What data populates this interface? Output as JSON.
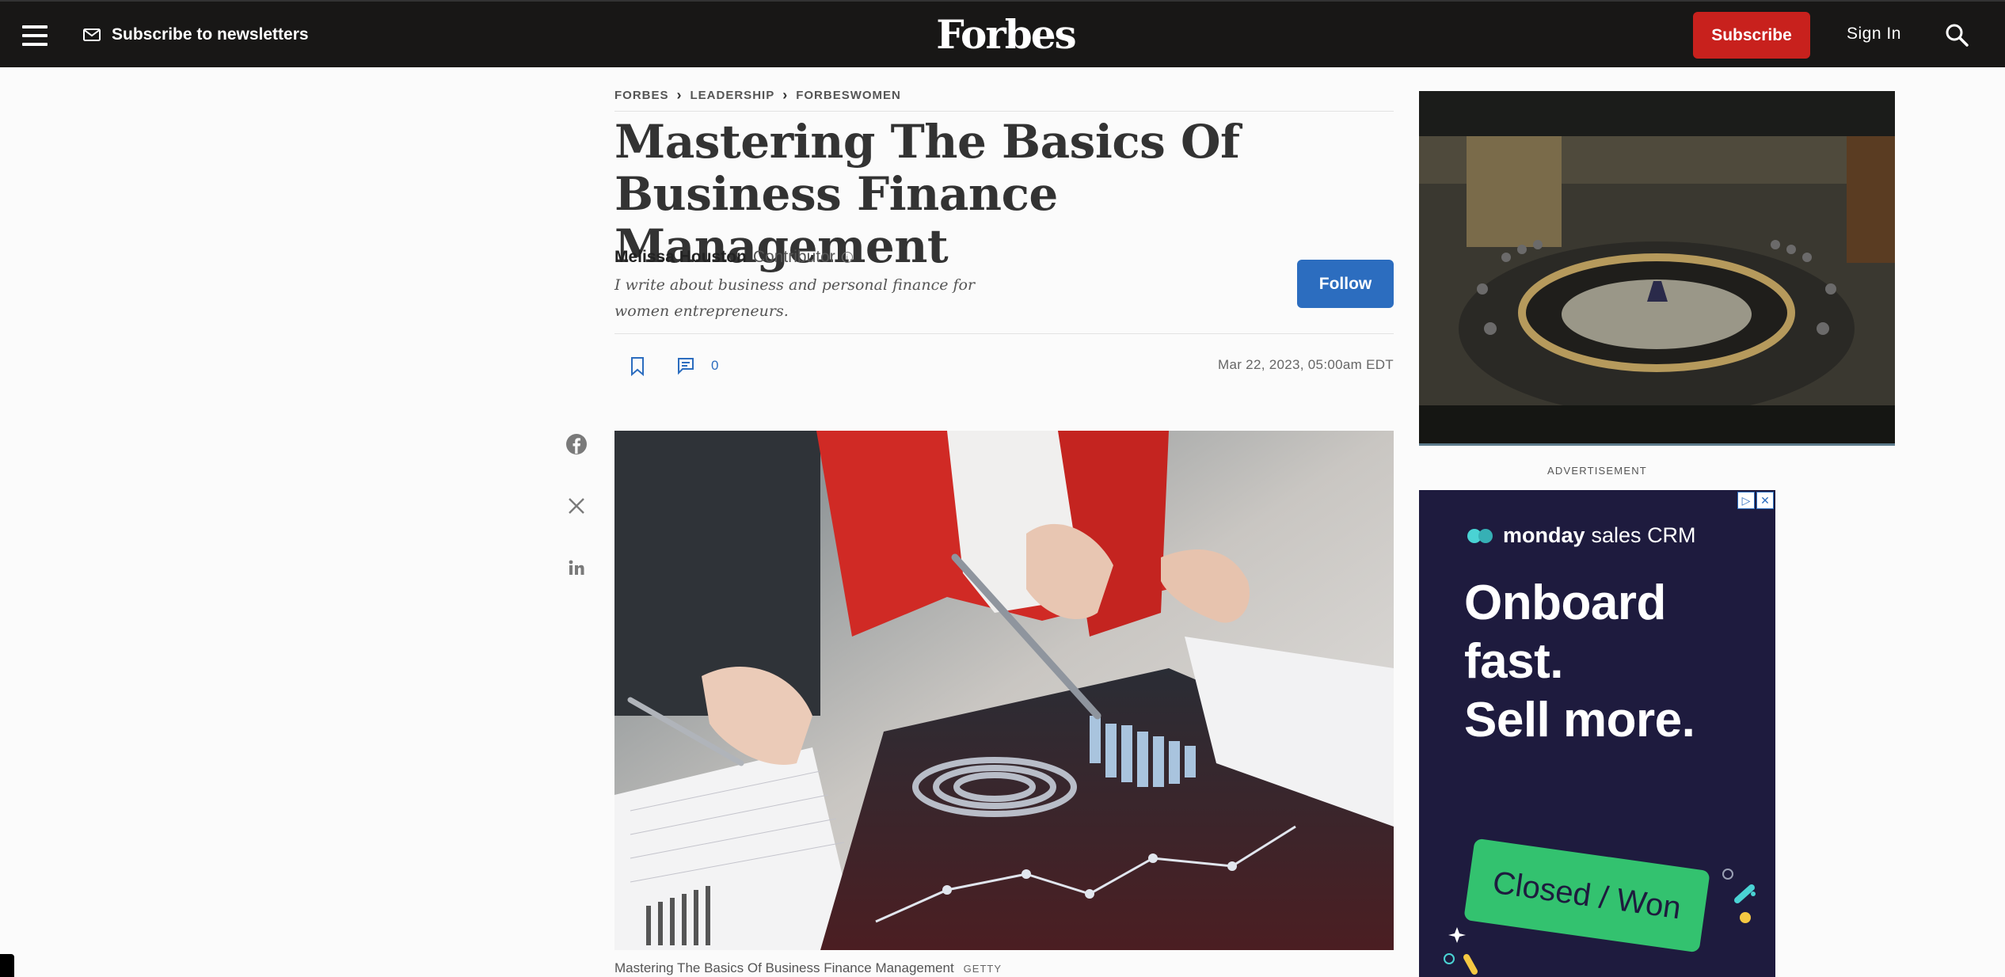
{
  "header": {
    "newsletter_label": "Subscribe to newsletters",
    "logo": "Forbes",
    "subscribe_label": "Subscribe",
    "signin_label": "Sign In"
  },
  "breadcrumb": [
    "FORBES",
    "LEADERSHIP",
    "FORBESWOMEN"
  ],
  "article": {
    "title": "Mastering The Basics Of Business Finance Management",
    "author": "Melissa Houston",
    "author_role": "Contributor",
    "bio": "I write about business and personal finance for women entrepreneurs.",
    "follow_label": "Follow",
    "comment_count": "0",
    "date": "Mar 22, 2023, 05:00am EDT",
    "image_caption": "Mastering The Basics Of Business Finance Management",
    "image_credit": "GETTY"
  },
  "share": [
    "facebook-icon",
    "x-icon",
    "linkedin-icon"
  ],
  "sidebar": {
    "ad_label": "ADVERTISEMENT",
    "ad": {
      "brand_bold": "monday",
      "brand_light": "sales CRM",
      "headline_1": "Onboard",
      "headline_2": "fast.",
      "headline_3": "Sell more.",
      "cta": "Closed / Won"
    }
  },
  "colors": {
    "header_bg": "#181716",
    "subscribe_red": "#c8211d",
    "follow_blue": "#2c6dbf",
    "ad_bg": "#1e1b3e",
    "ad_cta_green": "#33c26f"
  }
}
